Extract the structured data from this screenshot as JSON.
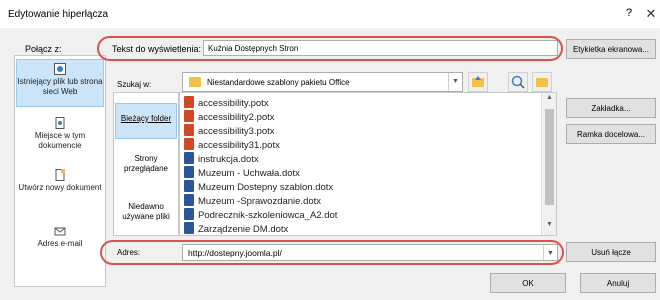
{
  "window": {
    "title": "Edytowanie hiperłącza",
    "help_glyph": "?",
    "close_glyph": "✕"
  },
  "link_to": {
    "label": "Połącz z:",
    "items": [
      {
        "label": "Istniejący plik lub strona sieci Web",
        "icon": "web-page-icon",
        "selected": true
      },
      {
        "label": "Miejsce w tym dokumencie",
        "icon": "document-place-icon",
        "selected": false
      },
      {
        "label": "Utwórz nowy dokument",
        "icon": "new-document-icon",
        "selected": false
      },
      {
        "label": "Adres e-mail",
        "icon": "email-icon",
        "selected": false
      }
    ]
  },
  "caption": {
    "label": "Tekst do wyświetlenia:",
    "value": "Kuźnia Dostępnych Stron"
  },
  "buttons": {
    "screen_tip": "Etykietka ekranowa...",
    "bookmark": "Zakładka...",
    "target_frame": "Ramka docelowa...",
    "remove_link": "Usuń łącze",
    "ok": "OK",
    "cancel": "Anuluj"
  },
  "look_in": {
    "label": "Szukaj w:",
    "folder": "Niestandardowe szablony pakietu Office"
  },
  "nav": {
    "items": [
      {
        "label": "Bieżący folder",
        "selected": true
      },
      {
        "label": "Strony przeglądane",
        "selected": false
      },
      {
        "label": "Niedawno używane pliki",
        "selected": false
      }
    ]
  },
  "files": [
    {
      "name": "accessibility.potx",
      "type": "powerpoint"
    },
    {
      "name": "accessibility2.potx",
      "type": "powerpoint"
    },
    {
      "name": "accessibility3.potx",
      "type": "powerpoint"
    },
    {
      "name": "accessibility31.potx",
      "type": "powerpoint"
    },
    {
      "name": "instrukcja.dotx",
      "type": "word"
    },
    {
      "name": "Muzeum - Uchwała.dotx",
      "type": "word"
    },
    {
      "name": "Muzeum Dostepny szablon.dotx",
      "type": "word"
    },
    {
      "name": "Muzeum -Sprawozdanie.dotx",
      "type": "word"
    },
    {
      "name": "Podrecznik-szkoleniowca_A2.dot",
      "type": "word"
    },
    {
      "name": "Zarządzenie DM.dotx",
      "type": "word"
    }
  ],
  "address": {
    "label": "Adres:",
    "value": "http://dostepny.joomla.pl/"
  },
  "colors": {
    "highlight": "#d9534f",
    "selected_bg": "#cce4f7"
  }
}
